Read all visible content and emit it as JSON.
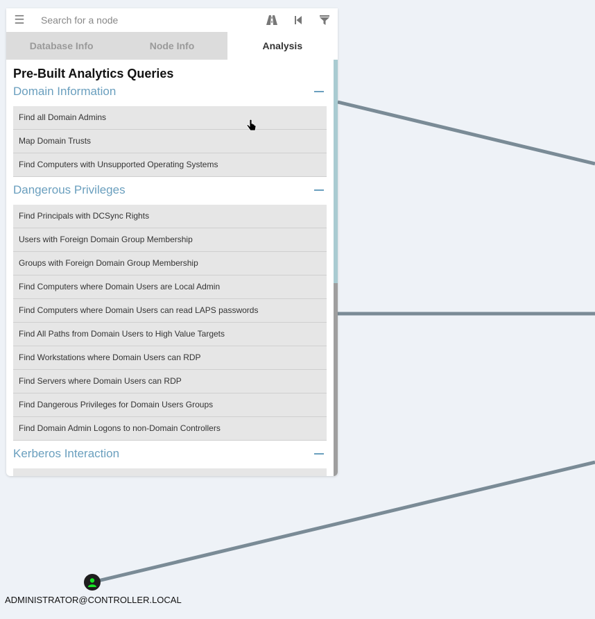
{
  "search": {
    "placeholder": "Search for a node"
  },
  "tabs": [
    {
      "label": "Database Info",
      "active": false
    },
    {
      "label": "Node Info",
      "active": false
    },
    {
      "label": "Analysis",
      "active": true
    }
  ],
  "content": {
    "title": "Pre-Built Analytics Queries",
    "sections": [
      {
        "title": "Domain Information",
        "queries": [
          "Find all Domain Admins",
          "Map Domain Trusts",
          "Find Computers with Unsupported Operating Systems"
        ]
      },
      {
        "title": "Dangerous Privileges",
        "queries": [
          "Find Principals with DCSync Rights",
          "Users with Foreign Domain Group Membership",
          "Groups with Foreign Domain Group Membership",
          "Find Computers where Domain Users are Local Admin",
          "Find Computers where Domain Users can read LAPS passwords",
          "Find All Paths from Domain Users to High Value Targets",
          "Find Workstations where Domain Users can RDP",
          "Find Servers where Domain Users can RDP",
          "Find Dangerous Privileges for Domain Users Groups",
          "Find Domain Admin Logons to non-Domain Controllers"
        ]
      },
      {
        "title": "Kerberos Interaction",
        "queries": []
      }
    ]
  },
  "graph": {
    "node_label": "ADMINISTRATOR@CONTROLLER.LOCAL"
  },
  "icons": {
    "menu": "hamburger-menu-icon",
    "pathfinding": "road-icon",
    "back": "step-backward-icon",
    "filter": "filter-icon",
    "collapse": "minus-icon",
    "node": "user-icon",
    "cursor": "hand-pointer-icon"
  },
  "colors": {
    "accent": "#6a9fbe",
    "edge": "#7a8b96",
    "node_person": "#17e625",
    "background": "#eef2f7"
  }
}
